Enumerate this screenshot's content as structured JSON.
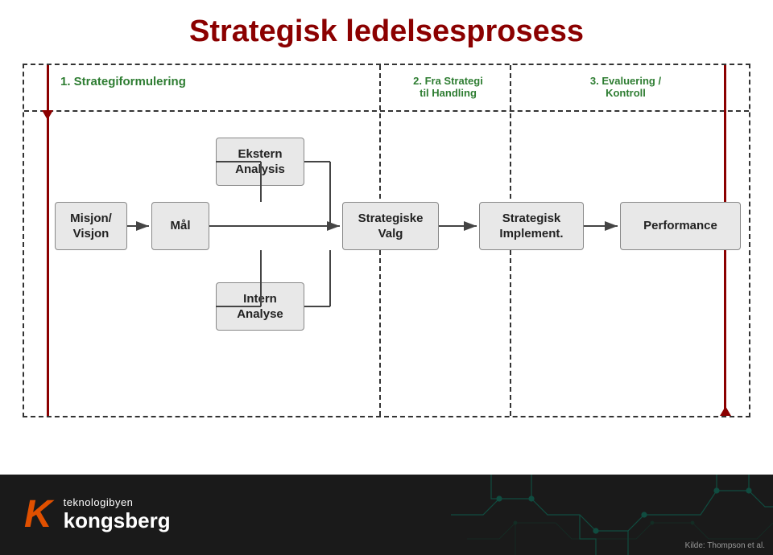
{
  "title": "Strategisk ledelsesprosess",
  "columns": {
    "col1_label": "1. Strategiformulering",
    "col2_label": "2. Fra Strategi\ntil Handling",
    "col3_label": "3. Evaluering /\nKontroll"
  },
  "boxes": {
    "misjon": "Misjon/\nVisjon",
    "maal": "Mål",
    "ekstern": "Ekstern\nAnalysis",
    "intern": "Intern\nAnalyse",
    "strategiske_valg": "Strategiske\nValg",
    "strategisk_impl": "Strategisk\nImplement.",
    "performance": "Performance"
  },
  "footer": {
    "city_label": "teknologibyen",
    "brand_label": "kongsberg",
    "source_label": "Kilde: Thompson et al."
  },
  "colors": {
    "title_red": "#8B0000",
    "header_green": "#2e7d32",
    "box_bg": "#e8e8e8",
    "arrow_color": "#444",
    "footer_bg": "#1a1a1a",
    "logo_orange": "#e05000"
  }
}
